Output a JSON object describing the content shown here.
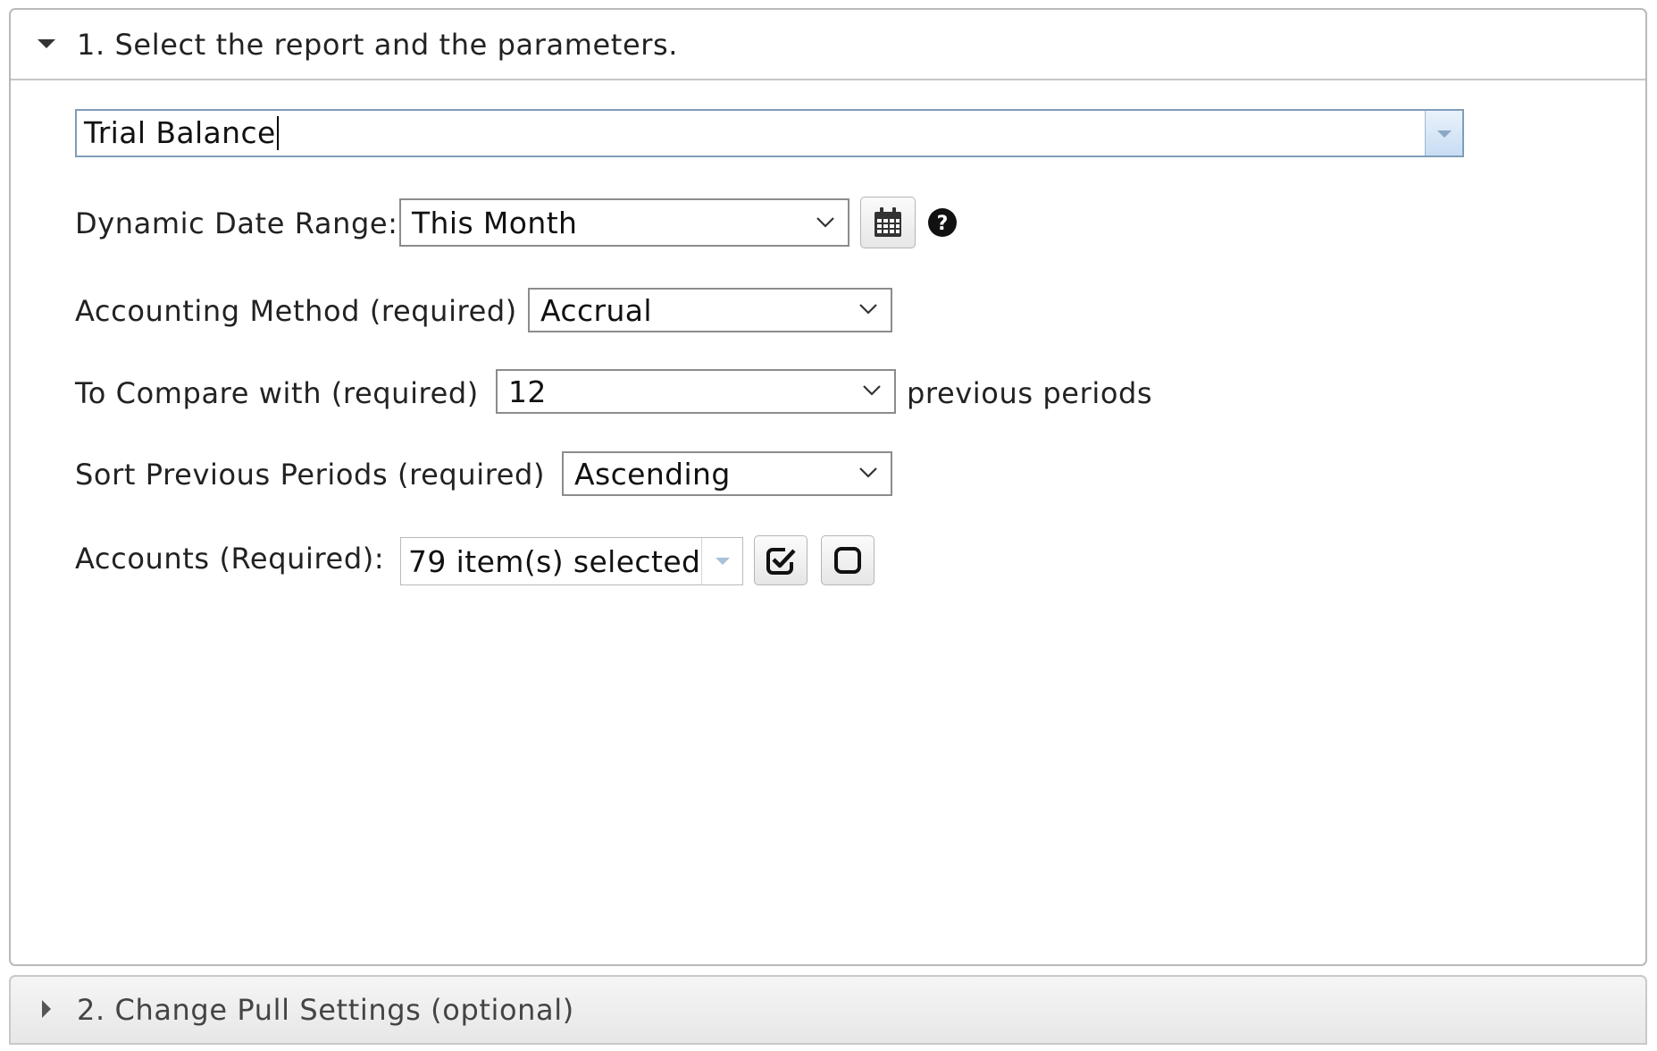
{
  "section1": {
    "title": "1. Select the report and the parameters.",
    "report": {
      "value": "Trial Balance"
    },
    "dynamic_date_range": {
      "label": "Dynamic Date Range:",
      "value": "This Month"
    },
    "accounting_method": {
      "label": "Accounting Method (required)",
      "value": "Accrual"
    },
    "compare_with": {
      "label": "To Compare with (required)",
      "value": "12",
      "suffix": "previous periods"
    },
    "sort_previous_periods": {
      "label": "Sort Previous Periods (required)",
      "value": "Ascending"
    },
    "accounts": {
      "label": "Accounts (Required):",
      "value": "79 item(s) selected"
    }
  },
  "section2": {
    "title": "2. Change Pull Settings (optional)"
  },
  "icons": {
    "expand": "triangle-down-icon",
    "collapse": "triangle-right-icon",
    "calendar": "calendar-icon",
    "help": "question-circle-icon",
    "select_all": "checked-square-icon",
    "deselect_all": "empty-square-icon",
    "dropdown": "chevron-down-icon"
  }
}
